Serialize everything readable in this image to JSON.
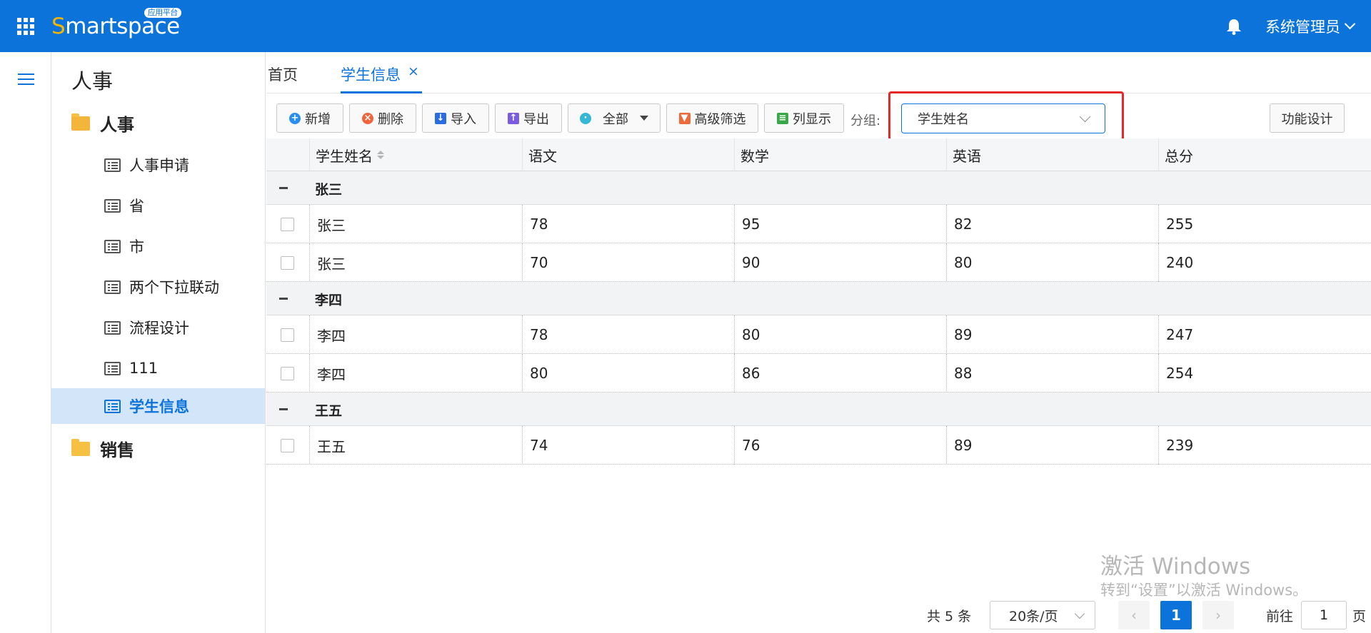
{
  "header": {
    "logo_first": "S",
    "logo_rest": "martspace",
    "logo_badge": "应用平台",
    "user_name": "系统管理员"
  },
  "sidebar": {
    "title": "人事",
    "folders": [
      {
        "label": "人事",
        "open": true
      },
      {
        "label": "销售",
        "open": false
      }
    ],
    "items": [
      {
        "label": "人事申请"
      },
      {
        "label": "省"
      },
      {
        "label": "市"
      },
      {
        "label": "两个下拉联动"
      },
      {
        "label": "流程设计"
      },
      {
        "label": "111"
      },
      {
        "label": "学生信息",
        "active": true
      }
    ]
  },
  "tabs": [
    {
      "label": "首页"
    },
    {
      "label": "学生信息",
      "active": true,
      "close": "×"
    }
  ],
  "toolbar": {
    "add": "新增",
    "delete": "删除",
    "import": "导入",
    "export": "导出",
    "all": "全部",
    "advanced_filter": "高级筛选",
    "column_display": "列显示",
    "group_label": "分组:",
    "group_value": "学生姓名",
    "design": "功能设计"
  },
  "table": {
    "columns": [
      "学生姓名",
      "语文",
      "数学",
      "英语",
      "总分"
    ],
    "groups": [
      {
        "name": "张三",
        "rows": [
          [
            "张三",
            "78",
            "95",
            "82",
            "255"
          ],
          [
            "张三",
            "70",
            "90",
            "80",
            "240"
          ]
        ]
      },
      {
        "name": "李四",
        "rows": [
          [
            "李四",
            "78",
            "80",
            "89",
            "247"
          ],
          [
            "李四",
            "80",
            "86",
            "88",
            "254"
          ]
        ]
      },
      {
        "name": "王五",
        "rows": [
          [
            "王五",
            "74",
            "76",
            "89",
            "239"
          ]
        ]
      }
    ]
  },
  "watermark": {
    "line1": "激活 Windows",
    "line2": "转到“设置”以激活 Windows。"
  },
  "pagination": {
    "total": "共 5 条",
    "page_size": "20条/页",
    "prev": "‹",
    "current": "1",
    "next": "›",
    "goto_label": "前往",
    "goto_value": "1",
    "page_suffix": "页"
  },
  "colors": {
    "brand": "#0b73d9",
    "highlight_box": "#e62828"
  }
}
